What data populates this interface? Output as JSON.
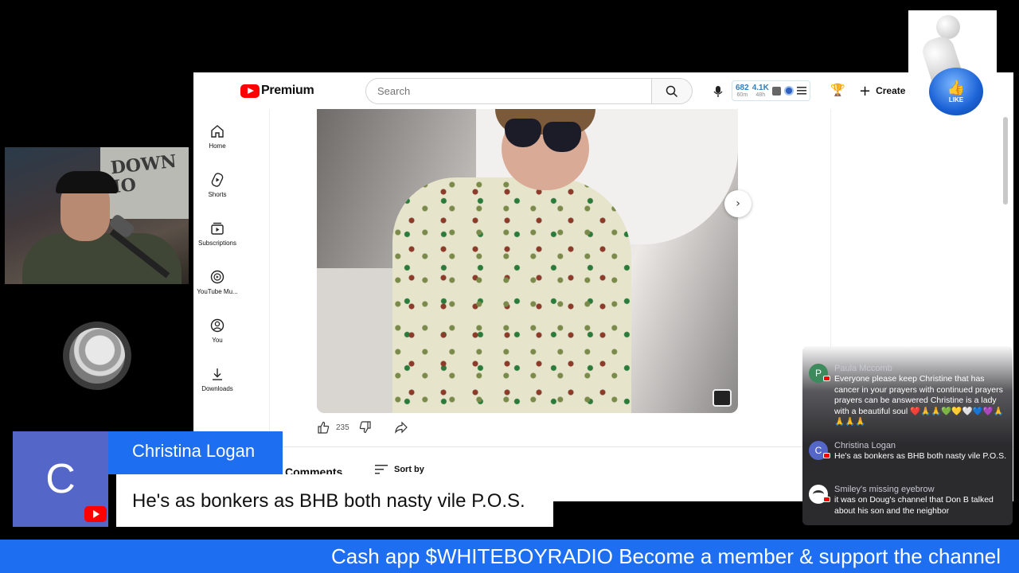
{
  "header": {
    "logo_text": "Premium",
    "search_placeholder": "Search",
    "ext_stat1_big": "682",
    "ext_stat1_small": "60m",
    "ext_stat2_big": "4.1K",
    "ext_stat2_small": "48h",
    "create_label": "Create"
  },
  "sidebar": {
    "items": [
      {
        "label": "Home",
        "icon": "home-icon"
      },
      {
        "label": "Shorts",
        "icon": "shorts-icon"
      },
      {
        "label": "Subscriptions",
        "icon": "subscriptions-icon"
      },
      {
        "label": "YouTube Mu...",
        "icon": "youtube-music-icon"
      },
      {
        "label": "You",
        "icon": "account-icon"
      },
      {
        "label": "Downloads",
        "icon": "download-icon"
      }
    ]
  },
  "post": {
    "like_count": "235",
    "comments_label": "Comments",
    "sort_label": "Sort by"
  },
  "overlay": {
    "like_label": "LIKE"
  },
  "chat": {
    "messages": [
      {
        "initial": "P",
        "name": "Paula Mccomb",
        "text": "Everyone please keep Christine that has cancer in your prayers with continued prayers prayers can be answered Christine is a lady with a beautiful soul ❤️🙏🙏💚💛🤍💙💜🙏🙏🙏🙏",
        "color": "#3d8a5c"
      },
      {
        "initial": "C",
        "name": "Christina Logan",
        "text": "He's as bonkers as BHB both nasty vile P.O.S.",
        "color": "#5466c7"
      },
      {
        "initial": "",
        "name": "Smiley's missing eyebrow",
        "text": "it was on Doug's channel that Don B talked about his son and the neighbor",
        "color": "#ffffff"
      }
    ]
  },
  "lower_third": {
    "initial": "C",
    "name": "Christina Logan",
    "message": "He's as bonkers as BHB both nasty vile P.O.S."
  },
  "ticker": {
    "text": "Cash app $WHITEBOYRADIO Become a member & support the channel"
  },
  "colors": {
    "accent_blue": "#1d6ef0",
    "youtube_red": "#ff0000",
    "lower_third_purple": "#5466c7"
  }
}
